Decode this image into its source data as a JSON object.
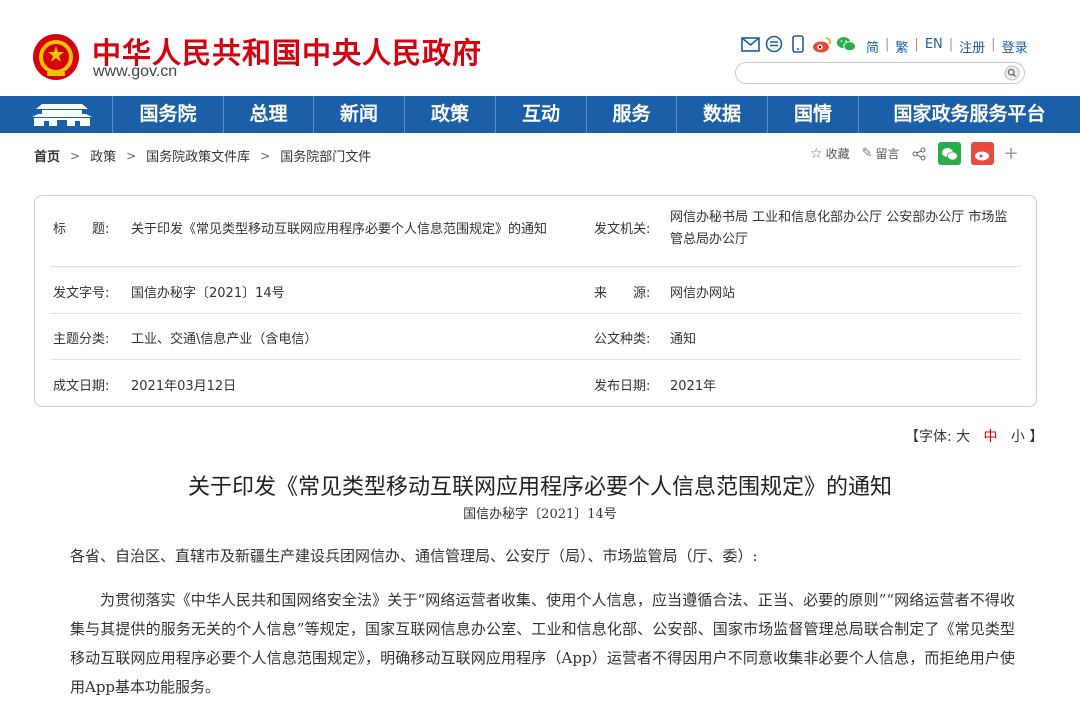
{
  "header": {
    "site_title": "中华人民共和国中央人民政府",
    "site_url": "www.gov.cn",
    "top_links": [
      "简",
      "繁",
      "EN",
      "注册",
      "登录"
    ],
    "search_placeholder": ""
  },
  "nav": {
    "items": [
      "国务院",
      "总理",
      "新闻",
      "政策",
      "互动",
      "服务",
      "数据",
      "国情",
      "国家政务服务平台"
    ]
  },
  "breadcrumb": [
    "首页",
    "政策",
    "国务院政策文件库",
    "国务院部门文件"
  ],
  "tools": {
    "favorite": "收藏",
    "comment": "留言"
  },
  "info": {
    "title_label": "标　　题:",
    "title_value": "关于印发《常见类型移动互联网应用程序必要个人信息范围规定》的通知",
    "issuer_label": "发文机关:",
    "issuer_value": "网信办秘书局  工业和信息化部办公厅  公安部办公厅  市场监管总局办公厅",
    "docno_label": "发文字号:",
    "docno_value": "国信办秘字〔2021〕14号",
    "source_label": "来　　源:",
    "source_value": "网信办网站",
    "topic_label": "主题分类:",
    "topic_value": "工业、交通\\信息产业（含电信）",
    "type_label": "公文种类:",
    "type_value": "通知",
    "date_label": "成文日期:",
    "date_value": "2021年03月12日",
    "pub_label": "发布日期:",
    "pub_value": "2021年"
  },
  "fontsize": {
    "prefix": "【字体:",
    "large": "大",
    "medium": "中",
    "small": "小",
    "suffix": "】"
  },
  "article": {
    "title": "关于印发《常见类型移动互联网应用程序必要个人信息范围规定》的通知",
    "docno": "国信办秘字〔2021〕14号",
    "salutation": "各省、自治区、直辖市及新疆生产建设兵团网信办、通信管理局、公安厅（局）、市场监管局（厅、委）:",
    "paragraph": "为贯彻落实《中华人民共和国网络安全法》关于“网络运营者收集、使用个人信息，应当遵循合法、正当、必要的原则”“网络运营者不得收集与其提供的服务无关的个人信息”等规定，国家互联网信息办公室、工业和信息化部、公安部、国家市场监督管理总局联合制定了《常见类型移动互联网应用程序必要个人信息范围规定》，明确移动互联网应用程序（App）运营者不得因用户不同意收集非必要个人信息，而拒绝用户使用App基本功能服务。"
  },
  "colors": {
    "brand_red": "#d7000f",
    "nav_blue": "#1b5fa8"
  }
}
